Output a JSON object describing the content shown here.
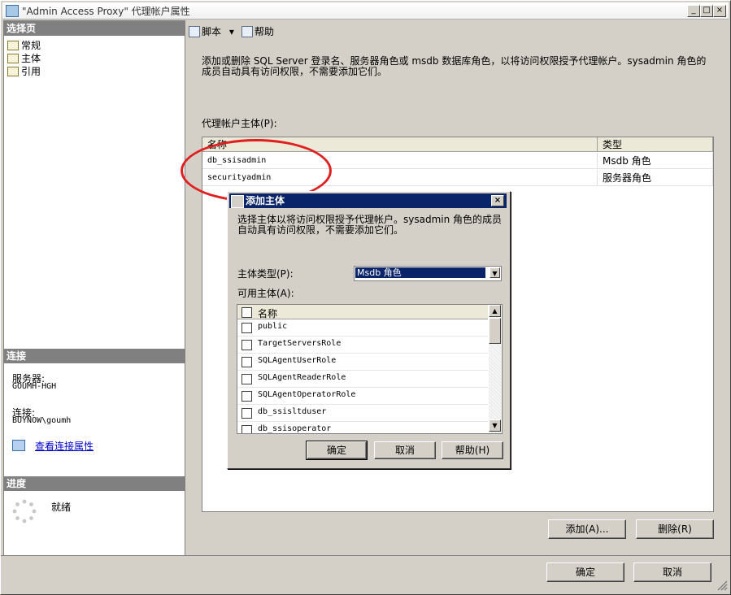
{
  "window": {
    "title": "\"Admin Access Proxy\" 代理帐户属性",
    "min_label": "_",
    "max_label": "□",
    "close_label": "×"
  },
  "left_pane": {
    "select_page_header": "选择页",
    "pages": [
      {
        "label": "常规",
        "icon": "page-icon"
      },
      {
        "label": "主体",
        "icon": "page-icon"
      },
      {
        "label": "引用",
        "icon": "page-icon"
      }
    ],
    "connection_header": "连接",
    "server_label": "服务器:",
    "server_value": "GOUMH-HGH",
    "connection_label": "连接:",
    "connection_value": "BUYNOW\\goumh",
    "view_conn_props": "查看连接属性",
    "progress_header": "进度",
    "progress_status": "就绪"
  },
  "toolbar": {
    "script_label": "脚本",
    "script_dropdown": "▾",
    "help_label": "帮助"
  },
  "main": {
    "description": "添加或删除 SQL Server 登录名、服务器角色或 msdb 数据库角色，以将访问权限授予代理帐户。sysadmin 角色的成员自动具有访问权限，不需要添加它们。",
    "proxy_principals_label": "代理帐户主体(P):",
    "grid": {
      "columns": [
        "名称",
        "类型"
      ],
      "rows": [
        {
          "name": "db_ssisadmin",
          "type": "Msdb 角色"
        },
        {
          "name": "securityadmin",
          "type": "服务器角色"
        }
      ]
    },
    "add_button": "添加(A)...",
    "remove_button": "删除(R)",
    "ok_button": "确定",
    "cancel_button": "取消"
  },
  "dialog": {
    "title": "添加主体",
    "close_label": "×",
    "description": "选择主体以将访问权限授予代理帐户。sysadmin 角色的成员自动具有访问权限，不需要添加它们。",
    "principal_type_label": "主体类型(P):",
    "principal_type_value": "Msdb 角色",
    "available_label": "可用主体(A):",
    "list_header": "名称",
    "items": [
      "public",
      "TargetServersRole",
      "SQLAgentUserRole",
      "SQLAgentReaderRole",
      "SQLAgentOperatorRole",
      "db_ssisltduser",
      "db_ssisoperator"
    ],
    "ok_button": "确定",
    "cancel_button": "取消",
    "help_button": "帮助(H)"
  },
  "colors": {
    "dialog_title_bg": "#0a246a",
    "highlight_ellipse": "#e02020",
    "link": "#0000cc"
  }
}
